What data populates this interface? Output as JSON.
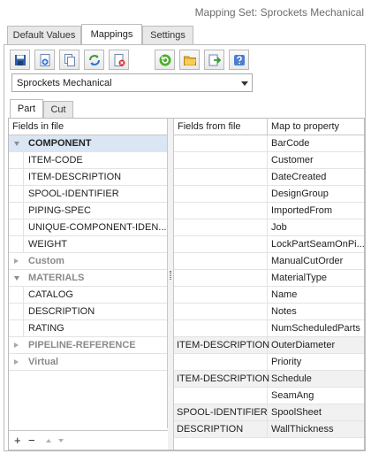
{
  "window": {
    "title": "Mapping Set: Sprockets Mechanical"
  },
  "tabs": [
    {
      "label": "Default Values",
      "active": false
    },
    {
      "label": "Mappings",
      "active": true
    },
    {
      "label": "Settings",
      "active": false
    }
  ],
  "toolbar": {
    "buttons": [
      {
        "name": "save-icon",
        "tooltip": "Save"
      },
      {
        "name": "add-icon",
        "tooltip": "New"
      },
      {
        "name": "copy-icon",
        "tooltip": "Copy"
      },
      {
        "name": "refresh-icon",
        "tooltip": "Refresh"
      },
      {
        "name": "delete-icon",
        "tooltip": "Delete"
      },
      {
        "name": "reload-icon",
        "tooltip": "Reload"
      },
      {
        "name": "open-folder-icon",
        "tooltip": "Open"
      },
      {
        "name": "export-icon",
        "tooltip": "Export"
      },
      {
        "name": "help-icon",
        "tooltip": "Help"
      }
    ]
  },
  "mapping_set": {
    "selected": "Sprockets Mechanical"
  },
  "sub_tabs": [
    {
      "label": "Part",
      "active": true
    },
    {
      "label": "Cut",
      "active": false
    }
  ],
  "left_grid": {
    "header": "Fields in file",
    "rows": [
      {
        "type": "group",
        "label": "COMPONENT",
        "expanded": true,
        "selected": true
      },
      {
        "type": "child",
        "label": "ITEM-CODE"
      },
      {
        "type": "child",
        "label": "ITEM-DESCRIPTION"
      },
      {
        "type": "child",
        "label": "SPOOL-IDENTIFIER"
      },
      {
        "type": "child",
        "label": "PIPING-SPEC"
      },
      {
        "type": "child",
        "label": "UNIQUE-COMPONENT-IDEN..."
      },
      {
        "type": "child",
        "label": "WEIGHT"
      },
      {
        "type": "group",
        "label": "Custom",
        "expanded": false
      },
      {
        "type": "group",
        "label": "MATERIALS",
        "expanded": true
      },
      {
        "type": "child",
        "label": "CATALOG"
      },
      {
        "type": "child",
        "label": "DESCRIPTION"
      },
      {
        "type": "child",
        "label": "RATING"
      },
      {
        "type": "group",
        "label": "PIPELINE-REFERENCE",
        "expanded": false
      },
      {
        "type": "group",
        "label": "Virtual",
        "expanded": false
      }
    ],
    "footer": {
      "add": "+",
      "remove": "−"
    }
  },
  "right_grid": {
    "header_file": "Fields from file",
    "header_prop": "Map to property",
    "rows": [
      {
        "file": "",
        "prop": "BarCode"
      },
      {
        "file": "",
        "prop": "Customer"
      },
      {
        "file": "",
        "prop": "DateCreated"
      },
      {
        "file": "",
        "prop": "DesignGroup"
      },
      {
        "file": "",
        "prop": "ImportedFrom"
      },
      {
        "file": "",
        "prop": "Job"
      },
      {
        "file": "",
        "prop": "LockPartSeamOnPi..."
      },
      {
        "file": "",
        "prop": "ManualCutOrder"
      },
      {
        "file": "",
        "prop": "MaterialType"
      },
      {
        "file": "",
        "prop": "Name"
      },
      {
        "file": "",
        "prop": "Notes"
      },
      {
        "file": "",
        "prop": "NumScheduledParts"
      },
      {
        "file": "ITEM-DESCRIPTION",
        "prop": "OuterDiameter"
      },
      {
        "file": "",
        "prop": "Priority"
      },
      {
        "file": "ITEM-DESCRIPTION",
        "prop": "Schedule"
      },
      {
        "file": "",
        "prop": "SeamAng"
      },
      {
        "file": "SPOOL-IDENTIFIER",
        "prop": "SpoolSheet"
      },
      {
        "file": "DESCRIPTION",
        "prop": "WallThickness"
      }
    ]
  }
}
